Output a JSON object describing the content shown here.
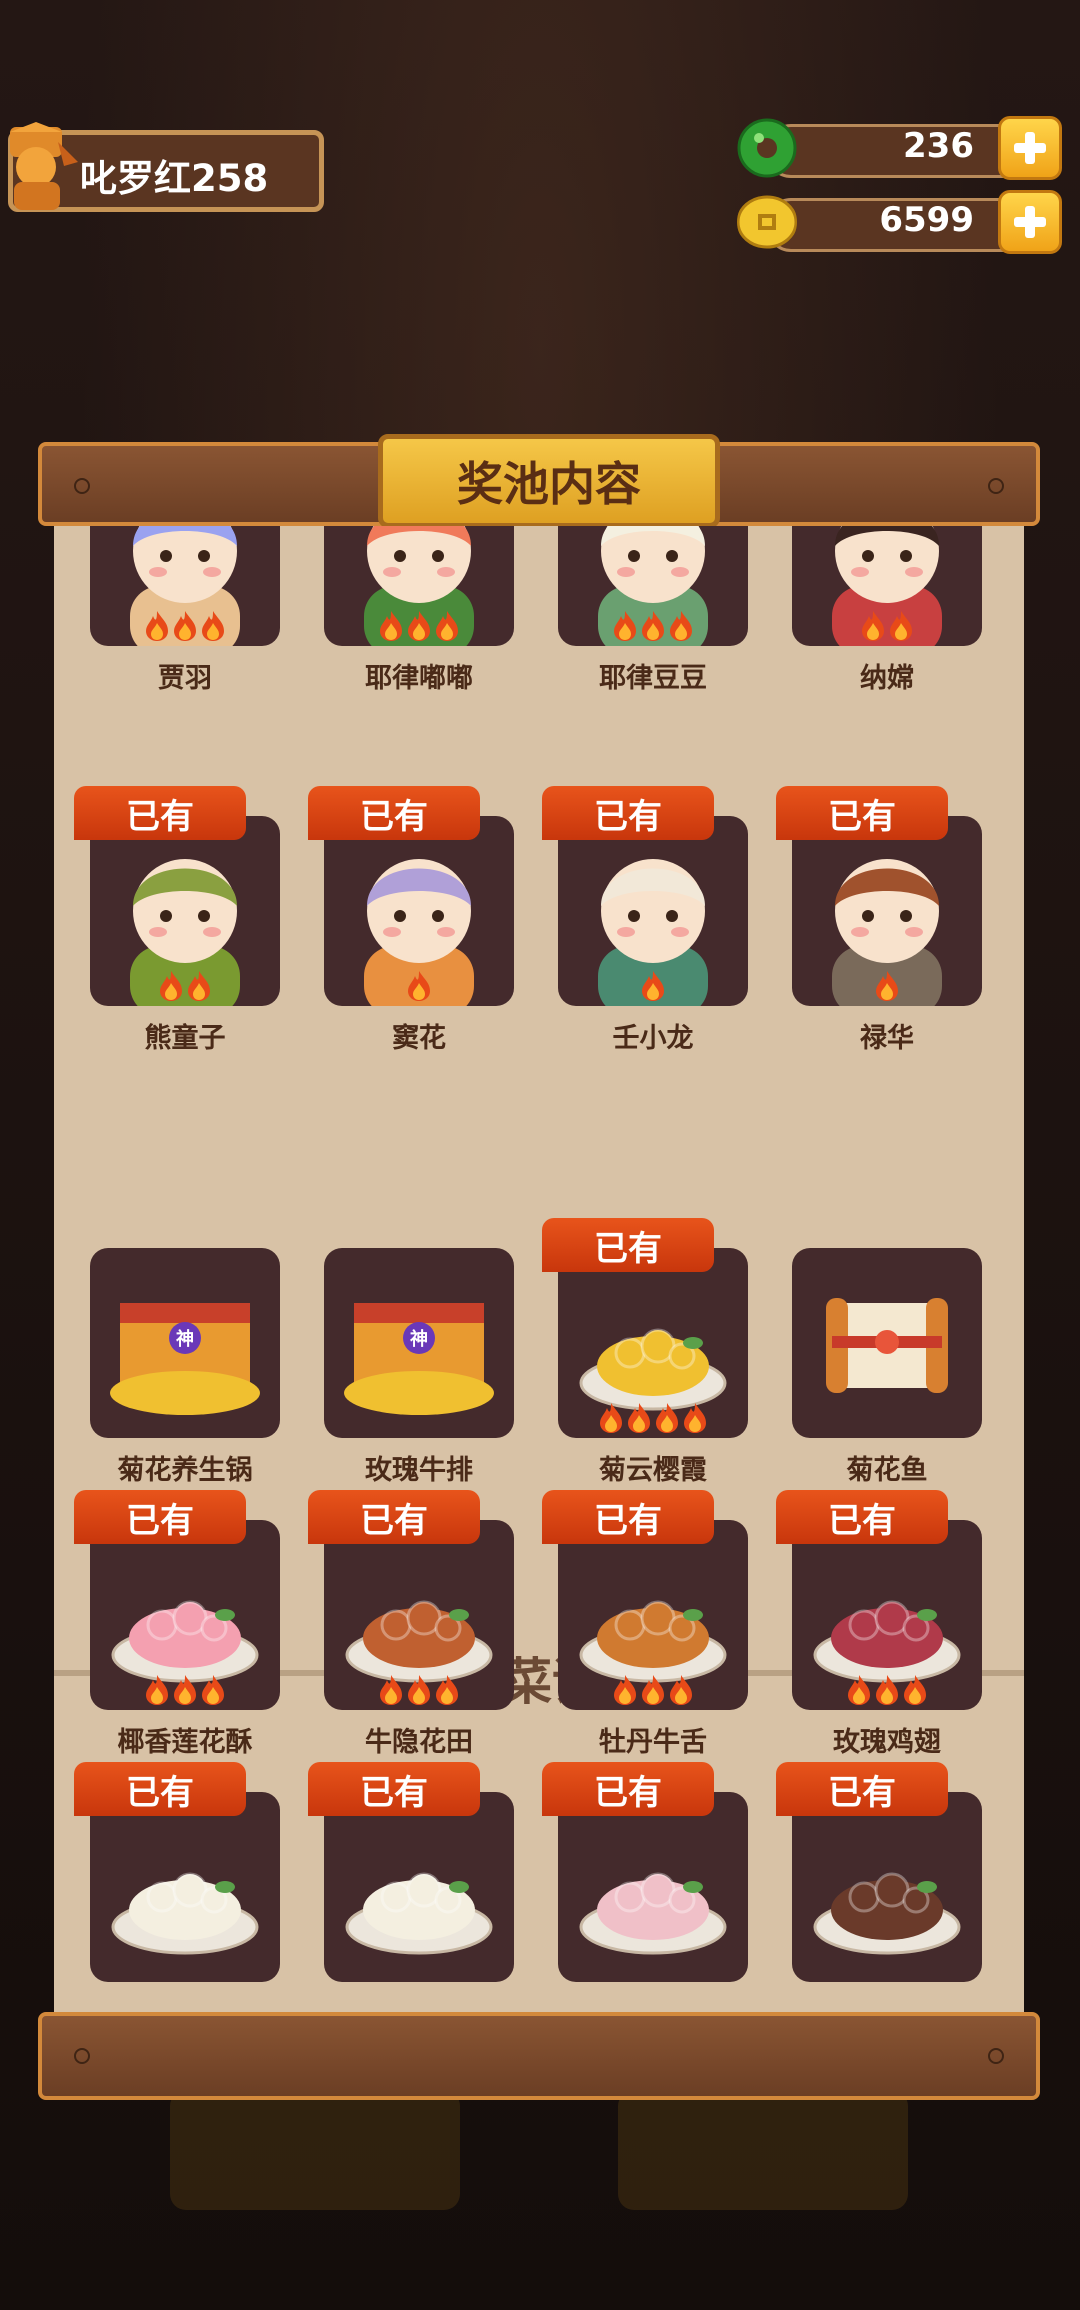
{
  "player": {
    "name": "叱罗红258"
  },
  "currencies": [
    {
      "icon": "jade-icon",
      "value": "236"
    },
    {
      "icon": "gold-coin-icon",
      "value": "6599"
    }
  ],
  "panel": {
    "title": "奖池内容"
  },
  "owned_label": "已有",
  "characters": [
    {
      "name": "贾羽",
      "owned": false,
      "flames": 3
    },
    {
      "name": "耶律嘟嘟",
      "owned": false,
      "flames": 3
    },
    {
      "name": "耶律豆豆",
      "owned": false,
      "flames": 3
    },
    {
      "name": "纳嫦",
      "owned": false,
      "flames": 2
    },
    {
      "name": "熊童子",
      "owned": true,
      "flames": 2
    },
    {
      "name": "窦花",
      "owned": true,
      "flames": 1
    },
    {
      "name": "壬小龙",
      "owned": true,
      "flames": 1
    },
    {
      "name": "禄华",
      "owned": true,
      "flames": 1
    }
  ],
  "recipe_section": {
    "title": "菜谱",
    "help": "?"
  },
  "recipes": [
    {
      "name": "菊花养生锅",
      "owned": false,
      "flames": 0,
      "badge": "神"
    },
    {
      "name": "玫瑰牛排",
      "owned": false,
      "flames": 0,
      "badge": "神"
    },
    {
      "name": "菊云樱霞",
      "owned": true,
      "flames": 4
    },
    {
      "name": "菊花鱼",
      "owned": false,
      "flames": 0
    },
    {
      "name": "椰香莲花酥",
      "owned": true,
      "flames": 3
    },
    {
      "name": "牛隐花田",
      "owned": true,
      "flames": 3
    },
    {
      "name": "牡丹牛舌",
      "owned": true,
      "flames": 3
    },
    {
      "name": "玫瑰鸡翅",
      "owned": true,
      "flames": 3
    },
    {
      "name": "",
      "owned": true,
      "flames": 0
    },
    {
      "name": "",
      "owned": true,
      "flames": 0
    },
    {
      "name": "",
      "owned": true,
      "flames": 0
    },
    {
      "name": "",
      "owned": true,
      "flames": 0
    }
  ],
  "colors": {
    "owned_badge": "#e0481a",
    "panel_bg": "#d8c2a6",
    "card_bg": "#442a2c"
  }
}
